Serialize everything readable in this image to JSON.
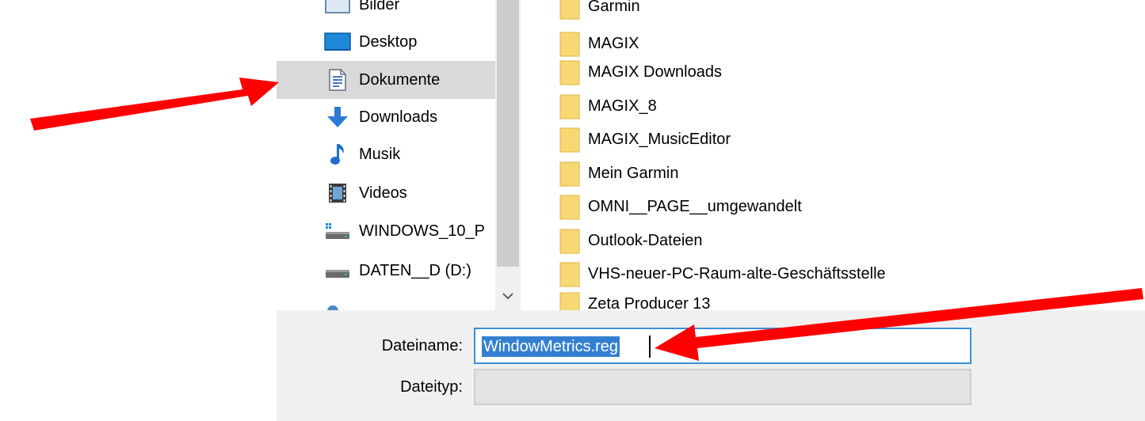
{
  "nav_items": [
    {
      "label": "Bilder",
      "icon": "pictures-icon",
      "selected": false
    },
    {
      "label": "Desktop",
      "icon": "desktop-icon",
      "selected": false
    },
    {
      "label": "Dokumente",
      "icon": "documents-icon",
      "selected": true
    },
    {
      "label": "Downloads",
      "icon": "downloads-icon",
      "selected": false
    },
    {
      "label": "Musik",
      "icon": "music-icon",
      "selected": false
    },
    {
      "label": "Videos",
      "icon": "videos-icon",
      "selected": false
    },
    {
      "label": "WINDOWS_10_P",
      "icon": "system-drive-icon",
      "selected": false
    },
    {
      "label": "DATEN__D (D:)",
      "icon": "drive-icon",
      "selected": false
    }
  ],
  "folders": [
    "Garmin",
    "MAGIX",
    "MAGIX Downloads",
    "MAGIX_8",
    "MAGIX_MusicEditor",
    "Mein Garmin",
    "OMNI__PAGE__umgewandelt",
    "Outlook-Dateien",
    "VHS-neuer-PC-Raum-alte-Geschäftsstelle",
    "Zeta Producer 13"
  ],
  "dialog": {
    "filename_label": "Dateiname:",
    "filename_value": "WindowMetrics.reg",
    "filetype_label": "Dateityp:",
    "filetype_value": ""
  },
  "colors": {
    "selection": "#d9d9d9",
    "accent": "#3380d0",
    "folder": "#f8d775",
    "arrow": "#ff0000"
  }
}
